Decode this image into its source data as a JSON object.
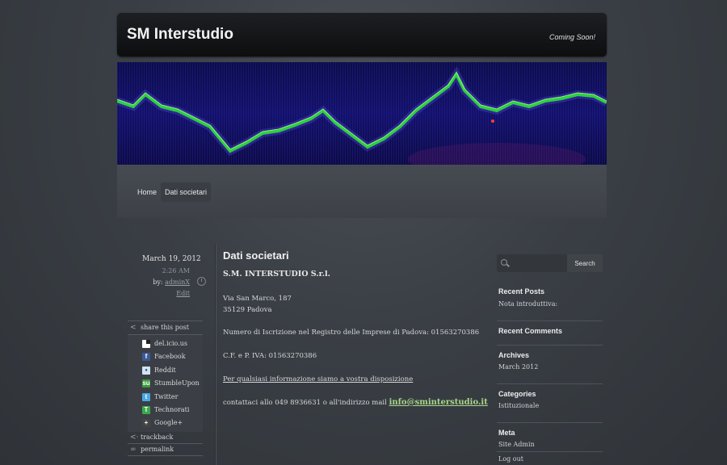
{
  "site": {
    "title": "SM Interstudio",
    "tagline": "Coming Soon!"
  },
  "nav": {
    "items": [
      "Home",
      "Dati societari"
    ]
  },
  "post": {
    "date": "March 19, 2012",
    "time": "2:26 AM",
    "by_label": "by:",
    "author": "adminX",
    "edit": "Edit",
    "title": "Dati societari",
    "company": "S.M. INTERSTUDIO S.r.l.",
    "address_line1": "Via San Marco, 187",
    "address_line2": "35129 Padova",
    "registry": "Numero di Iscrizione nel Registro delle Imprese di Padova: 01563270386",
    "vat": "C.F. e P. IVA: 01563270386",
    "info_link": "Per qualsiasi informazione siamo a vostra disposizione",
    "contact_prefix": "contattaci allo 049 8936631 o all'indirizzo mail",
    "email": "info@sminterstudio.it"
  },
  "share": {
    "heading": "share this post",
    "items": [
      "del.icio.us",
      "Facebook",
      "Reddit",
      "StumbleUpon",
      "Twitter",
      "Technorati",
      "Google+"
    ],
    "trackback": "trackback",
    "permalink": "permalink"
  },
  "sidebar": {
    "search_button": "Search",
    "search_placeholder": "",
    "recent_posts_title": "Recent Posts",
    "recent_posts": [
      "Nota introduttiva:"
    ],
    "recent_comments_title": "Recent Comments",
    "archives_title": "Archives",
    "archives": [
      "March 2012"
    ],
    "categories_title": "Categories",
    "categories": [
      "Istituzionale"
    ],
    "meta_title": "Meta",
    "meta": [
      "Site Admin",
      "Log out"
    ]
  }
}
